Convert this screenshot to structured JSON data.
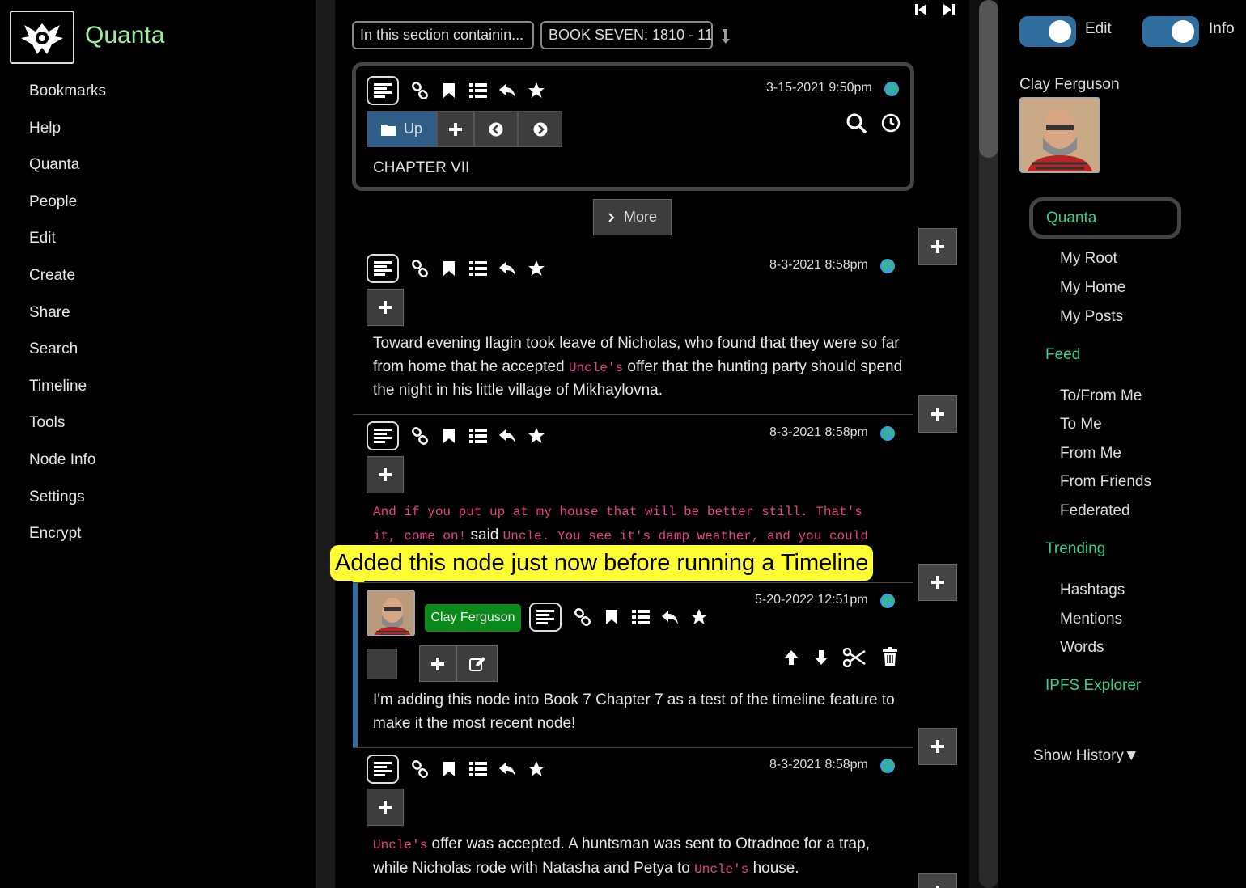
{
  "app": {
    "title": "Quanta",
    "logo_icon": "eagle-logo-icon"
  },
  "left_menu": [
    "Bookmarks",
    "Help",
    "Quanta",
    "People",
    "Edit",
    "Create",
    "Share",
    "Search",
    "Timeline",
    "Tools",
    "Node Info",
    "Settings",
    "Encrypt"
  ],
  "breadcrumbs": [
    "In this section containin...",
    "BOOK SEVEN: 1810 - 11"
  ],
  "header_node": {
    "date": "3-15-2021 9:50pm",
    "buttons": {
      "up": "Up"
    },
    "title": "CHAPTER VII"
  },
  "more_button": "More",
  "nodes": [
    {
      "date": "8-3-2021 8:58pm",
      "text_parts": [
        {
          "t": "Toward evening Ilagin took leave of Nicholas, who found that they were so far from home that he accepted ",
          "mono": false
        },
        {
          "t": "Uncle's",
          "mono": true
        },
        {
          "t": " offer that the hunting party should spend the night in his little village of Mikhaylovna.",
          "mono": false
        }
      ]
    },
    {
      "date": "8-3-2021 8:58pm",
      "line1": "And if you put up at my house that will be better still. That's",
      "line2_a": "it, come on!",
      "line2_b": " said ",
      "line2_c": "Uncle. You see it's damp weather, and you could"
    },
    {
      "date": "5-20-2022 12:51pm",
      "author": "Clay Ferguson",
      "text": "I'm adding this node into Book 7 Chapter 7 as a test of the timeline feature to make it the most recent node!"
    },
    {
      "date": "8-3-2021 8:58pm",
      "text_parts": [
        {
          "t": "Uncle's",
          "mono": true
        },
        {
          "t": " offer was accepted. A huntsman was sent to Otradnoe for a trap, while Nicholas rode with Natasha and Petya to ",
          "mono": false
        },
        {
          "t": "Uncle's",
          "mono": true
        },
        {
          "t": " house.",
          "mono": false
        }
      ]
    }
  ],
  "tooltip": "Added this node just now before running a Timeline",
  "right_panel": {
    "toggles": [
      "Edit",
      "Info"
    ],
    "user_name": "Clay Ferguson",
    "quanta_button": "Quanta",
    "my_items": [
      "My Root",
      "My Home",
      "My Posts"
    ],
    "feed_head": "Feed",
    "feed_items": [
      "To/From Me",
      "To Me",
      "From Me",
      "From Friends",
      "Federated"
    ],
    "trending_head": "Trending",
    "trending_items": [
      "Hashtags",
      "Mentions",
      "Words"
    ],
    "ipfs": "IPFS Explorer",
    "show_history": "Show History▼"
  },
  "colors": {
    "accent_green": "#35d08a",
    "logo_green": "#9ef09e",
    "toggle_blue": "#2f6d9f",
    "mono_pink": "#e83e8c",
    "tooltip_yellow": "#ffff33",
    "author_badge": "#0a8a1a"
  }
}
